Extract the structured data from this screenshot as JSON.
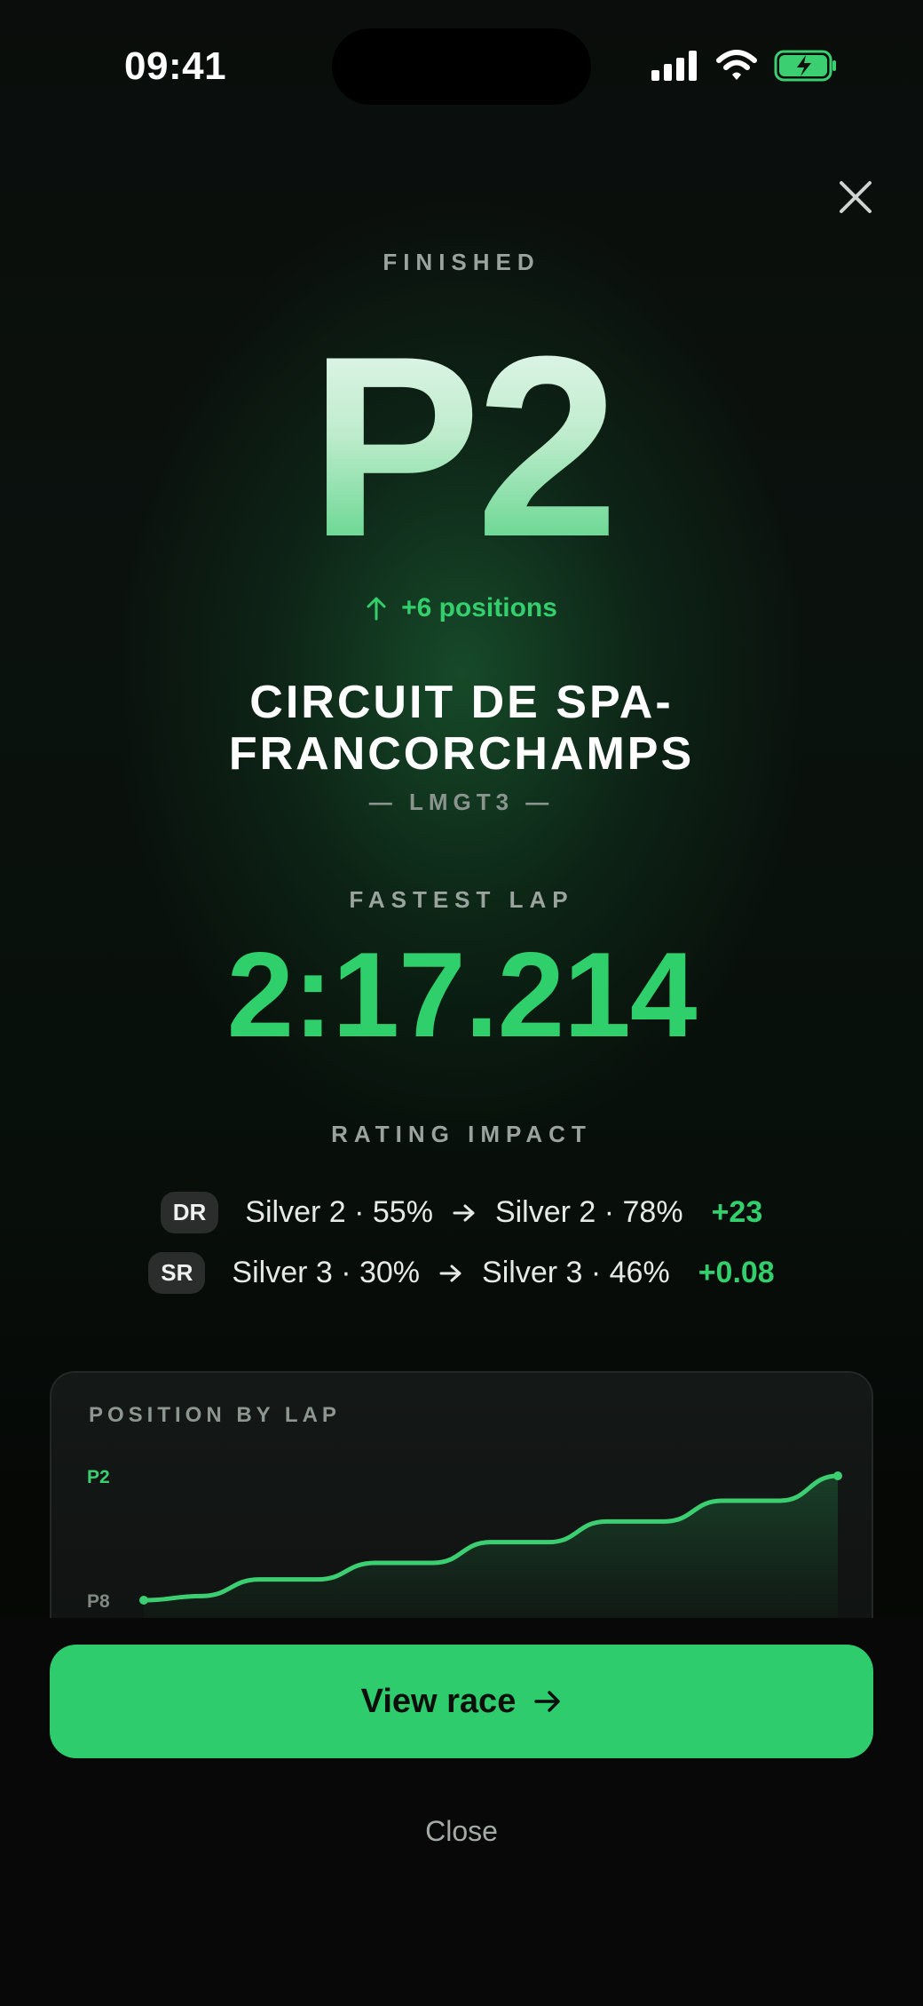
{
  "status_bar": {
    "time": "09:41"
  },
  "result": {
    "eyebrow": "FINISHED",
    "position": "P2",
    "position_change": "+6 positions",
    "track_name_line1": "CIRCUIT DE SPA-",
    "track_name_line2": "FRANCORCHAMPS",
    "car_class": "— LMGT3 —"
  },
  "fastest_lap": {
    "label": "FASTEST LAP",
    "time": "2:17.214"
  },
  "rating_impact": {
    "label": "RATING IMPACT",
    "rows": [
      {
        "badge": "DR",
        "before": "Silver 2 · 55%",
        "after": "Silver 2 · 78%",
        "delta": "+23"
      },
      {
        "badge": "SR",
        "before": "Silver 3 · 30%",
        "after": "Silver 3 · 46%",
        "delta": "+0.08"
      }
    ]
  },
  "position_chart": {
    "title": "POSITION BY LAP",
    "top_label": "P2",
    "bottom_label": "P8"
  },
  "chart_data": {
    "type": "line",
    "title": "POSITION BY LAP",
    "ylabels": [
      "P2",
      "P8"
    ],
    "ylim": [
      8,
      2
    ],
    "x": [
      1,
      2,
      3,
      4,
      5,
      6,
      7,
      8,
      9,
      10,
      11,
      12,
      13
    ],
    "series": [
      {
        "values": [
          8,
          7.8,
          7.0,
          7.0,
          6.2,
          6.2,
          5.2,
          5.2,
          4.2,
          4.2,
          3.2,
          3.2,
          2.0
        ]
      }
    ],
    "colors": {
      "line": "#3ccf72"
    }
  },
  "actions": {
    "primary": "View race",
    "secondary": "Close"
  },
  "colors": {
    "accent": "#2ecc6d",
    "background": "#050706"
  }
}
